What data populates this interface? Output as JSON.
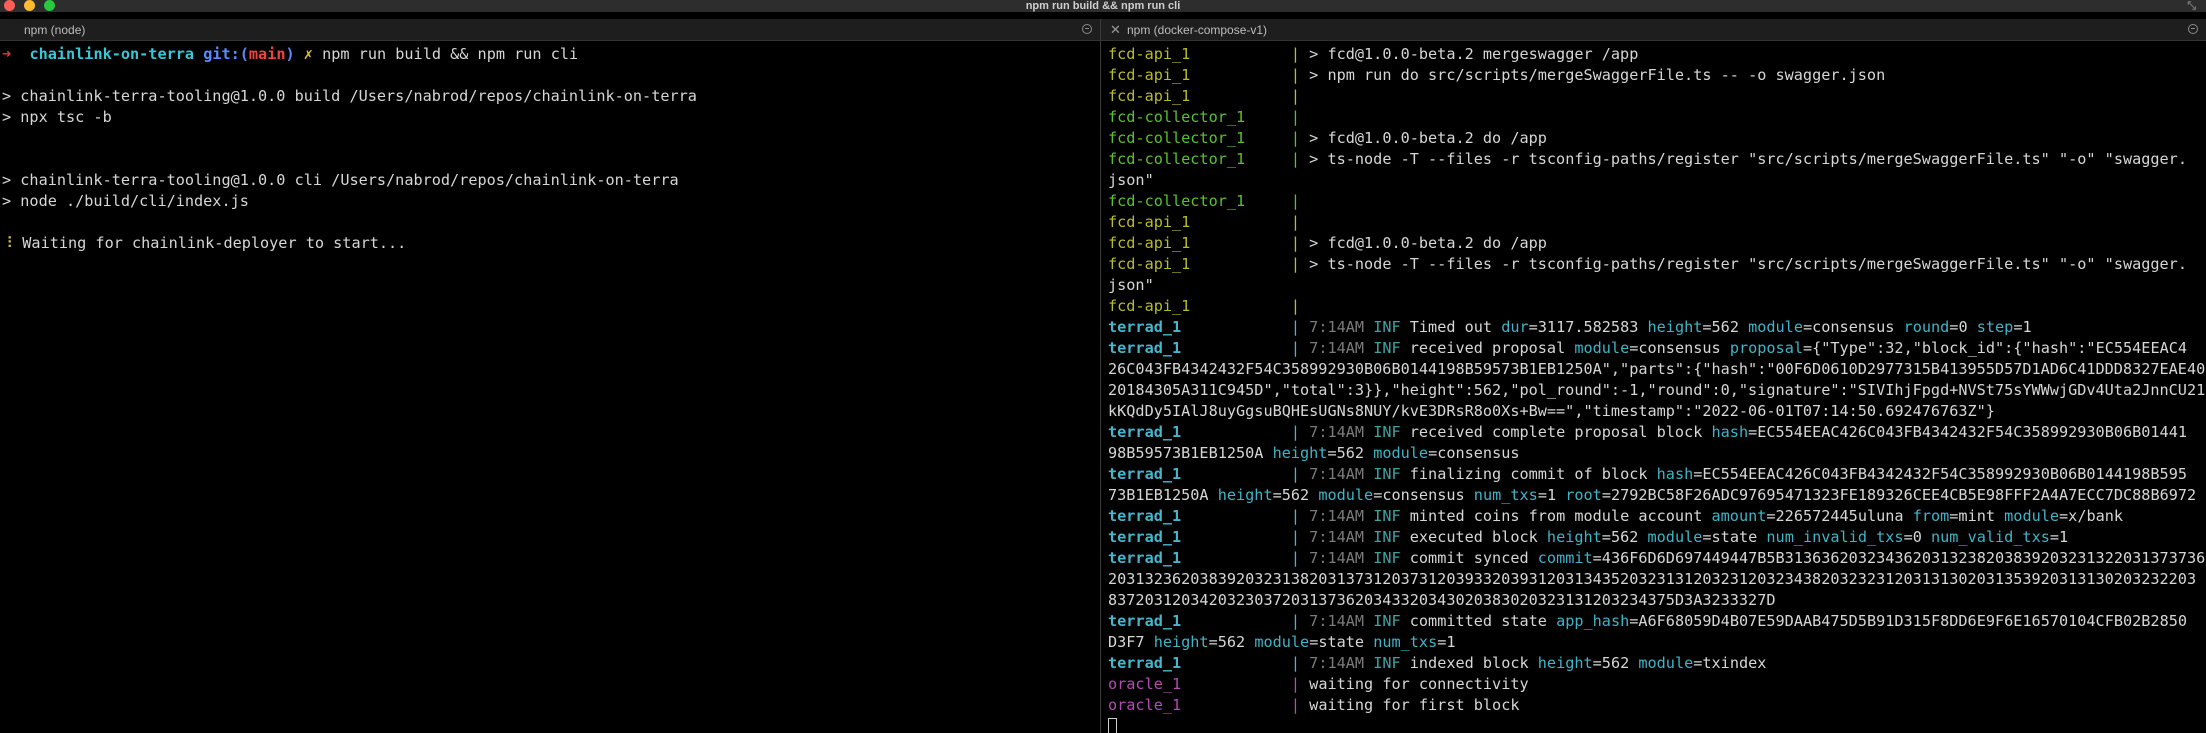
{
  "window": {
    "title": "npm run build && npm run cli",
    "traffic_colors": {
      "close": "#ff5f57",
      "minimize": "#febc2e",
      "maximize": "#28c840"
    }
  },
  "panes": {
    "left": {
      "tab": "npm (node)"
    },
    "right": {
      "tab": "npm (docker-compose-v1)"
    }
  },
  "left_terminal": {
    "prompt": {
      "arrow": "➜",
      "repo": "chainlink-on-terra",
      "git_label": "git:(",
      "branch": "main",
      "git_close": ")",
      "dirty": "✗",
      "command": "npm run build && npm run cli"
    },
    "lines": [
      "",
      "> chainlink-terra-tooling@1.0.0 build /Users/nabrod/repos/chainlink-on-terra",
      "> npx tsc -b",
      "",
      "",
      "> chainlink-terra-tooling@1.0.0 cli /Users/nabrod/repos/chainlink-on-terra",
      "> node ./build/cli/index.js",
      ""
    ],
    "status": {
      "spinner": "⠸",
      "text": "Waiting for chainlink-deployer to start..."
    }
  },
  "right_terminal": {
    "colors": {
      "fcd-api": "#b9bc2b",
      "fcd-collector": "#57c22e",
      "terrad": "#47b5cc",
      "oracle": "#b54bb5"
    },
    "lines": [
      {
        "src": "fcd-api_1",
        "kind": "api",
        "text": "> fcd@1.0.0-beta.2 mergeswagger /app"
      },
      {
        "src": "fcd-api_1",
        "kind": "api",
        "text": "> npm run do src/scripts/mergeSwaggerFile.ts -- -o swagger.json"
      },
      {
        "src": "fcd-api_1",
        "kind": "api",
        "text": ""
      },
      {
        "src": "fcd-collector_1",
        "kind": "coll",
        "text": ""
      },
      {
        "src": "fcd-collector_1",
        "kind": "coll",
        "text": "> fcd@1.0.0-beta.2 do /app"
      },
      {
        "src": "fcd-collector_1",
        "kind": "coll",
        "text": "> ts-node -T --files -r tsconfig-paths/register \"src/scripts/mergeSwaggerFile.ts\" \"-o\" \"swagger."
      },
      {
        "src": "",
        "kind": "cont",
        "text": "json\""
      },
      {
        "src": "fcd-collector_1",
        "kind": "coll",
        "text": ""
      },
      {
        "src": "fcd-api_1",
        "kind": "api",
        "text": ""
      },
      {
        "src": "fcd-api_1",
        "kind": "api",
        "text": "> fcd@1.0.0-beta.2 do /app"
      },
      {
        "src": "fcd-api_1",
        "kind": "api",
        "text": "> ts-node -T --files -r tsconfig-paths/register \"src/scripts/mergeSwaggerFile.ts\" \"-o\" \"swagger."
      },
      {
        "src": "",
        "kind": "cont",
        "text": "json\""
      },
      {
        "src": "fcd-api_1",
        "kind": "api",
        "text": ""
      },
      {
        "src": "terrad_1",
        "kind": "terrad",
        "segs": [
          [
            "ts",
            "7:14AM "
          ],
          [
            "inf",
            "INF "
          ],
          [
            "t",
            "Timed out "
          ],
          [
            "k",
            "dur"
          ],
          [
            "t",
            "=3117.582583 "
          ],
          [
            "k",
            "height"
          ],
          [
            "t",
            "=562 "
          ],
          [
            "k",
            "module"
          ],
          [
            "t",
            "=consensus "
          ],
          [
            "k",
            "round"
          ],
          [
            "t",
            "=0 "
          ],
          [
            "k",
            "step"
          ],
          [
            "t",
            "=1"
          ]
        ]
      },
      {
        "src": "terrad_1",
        "kind": "terrad",
        "segs": [
          [
            "ts",
            "7:14AM "
          ],
          [
            "inf",
            "INF "
          ],
          [
            "t",
            "received proposal "
          ],
          [
            "k",
            "module"
          ],
          [
            "t",
            "=consensus "
          ],
          [
            "k",
            "proposal"
          ],
          [
            "t",
            "={\"Type\":32,\"block_id\":{\"hash\":\"EC554EEAC4"
          ]
        ]
      },
      {
        "src": "",
        "kind": "cont",
        "text": "26C043FB4342432F54C358992930B06B0144198B59573B1EB1250A\",\"parts\":{\"hash\":\"00F6D0610D2977315B413955D57D1AD6C41DDD8327EAE40"
      },
      {
        "src": "",
        "kind": "cont",
        "text": "20184305A311C945D\",\"total\":3}},\"height\":562,\"pol_round\":-1,\"round\":0,\"signature\":\"SIVIhjFpgd+NVSt75sYWWwjGDv4Uta2JnnCU21"
      },
      {
        "src": "",
        "kind": "cont",
        "text": "kKQdDy5IAlJ8uyGgsuBQHEsUGNs8NUY/kvE3DRsR8o0Xs+Bw==\",\"timestamp\":\"2022-06-01T07:14:50.692476763Z\"}"
      },
      {
        "src": "terrad_1",
        "kind": "terrad",
        "segs": [
          [
            "ts",
            "7:14AM "
          ],
          [
            "inf",
            "INF "
          ],
          [
            "t",
            "received complete proposal block "
          ],
          [
            "k",
            "hash"
          ],
          [
            "t",
            "=EC554EEAC426C043FB4342432F54C358992930B06B01441"
          ]
        ]
      },
      {
        "src": "",
        "kind": "cont",
        "segs": [
          [
            "t",
            "98B59573B1EB1250A "
          ],
          [
            "k",
            "height"
          ],
          [
            "t",
            "=562 "
          ],
          [
            "k",
            "module"
          ],
          [
            "t",
            "=consensus"
          ]
        ]
      },
      {
        "src": "terrad_1",
        "kind": "terrad",
        "segs": [
          [
            "ts",
            "7:14AM "
          ],
          [
            "inf",
            "INF "
          ],
          [
            "t",
            "finalizing commit of block "
          ],
          [
            "k",
            "hash"
          ],
          [
            "t",
            "=EC554EEAC426C043FB4342432F54C358992930B06B0144198B595"
          ]
        ]
      },
      {
        "src": "",
        "kind": "cont",
        "segs": [
          [
            "t",
            "73B1EB1250A "
          ],
          [
            "k",
            "height"
          ],
          [
            "t",
            "=562 "
          ],
          [
            "k",
            "module"
          ],
          [
            "t",
            "=consensus "
          ],
          [
            "k",
            "num_txs"
          ],
          [
            "t",
            "=1 "
          ],
          [
            "k",
            "root"
          ],
          [
            "t",
            "=2792BC58F26ADC97695471323FE189326CEE4CB5E98FFF2A4A7ECC7DC88B6972"
          ]
        ]
      },
      {
        "src": "terrad_1",
        "kind": "terrad",
        "segs": [
          [
            "ts",
            "7:14AM "
          ],
          [
            "inf",
            "INF "
          ],
          [
            "t",
            "minted coins from module account "
          ],
          [
            "k",
            "amount"
          ],
          [
            "t",
            "=226572445uluna "
          ],
          [
            "k",
            "from"
          ],
          [
            "t",
            "=mint "
          ],
          [
            "k",
            "module"
          ],
          [
            "t",
            "=x/bank"
          ]
        ]
      },
      {
        "src": "terrad_1",
        "kind": "terrad",
        "segs": [
          [
            "ts",
            "7:14AM "
          ],
          [
            "inf",
            "INF "
          ],
          [
            "t",
            "executed block "
          ],
          [
            "k",
            "height"
          ],
          [
            "t",
            "=562 "
          ],
          [
            "k",
            "module"
          ],
          [
            "t",
            "=state "
          ],
          [
            "k",
            "num_invalid_txs"
          ],
          [
            "t",
            "=0 "
          ],
          [
            "k",
            "num_valid_txs"
          ],
          [
            "t",
            "=1"
          ]
        ]
      },
      {
        "src": "terrad_1",
        "kind": "terrad",
        "segs": [
          [
            "ts",
            "7:14AM "
          ],
          [
            "inf",
            "INF "
          ],
          [
            "t",
            "commit synced "
          ],
          [
            "k",
            "commit"
          ],
          [
            "t",
            "=436F6D6D697449447B5B3136362032343620313238203839203231322031373736"
          ]
        ]
      },
      {
        "src": "",
        "kind": "cont",
        "text": "20313236203839203231382031373120373120393320393120313435203231312032312032343820323231203131302031353920313130203232203"
      },
      {
        "src": "",
        "kind": "cont",
        "text": "8372031203420323037203137362034332034302038302032313120323437​5D3A3233327D"
      },
      {
        "src": "terrad_1",
        "kind": "terrad",
        "segs": [
          [
            "ts",
            "7:14AM "
          ],
          [
            "inf",
            "INF "
          ],
          [
            "t",
            "committed state "
          ],
          [
            "k",
            "app_hash"
          ],
          [
            "t",
            "=A6F68059D4B07E59DAAB475D5B91D315F8DD6E9F6E16570104CFB02B2850"
          ]
        ]
      },
      {
        "src": "",
        "kind": "cont",
        "segs": [
          [
            "t",
            "D3F7 "
          ],
          [
            "k",
            "height"
          ],
          [
            "t",
            "=562 "
          ],
          [
            "k",
            "module"
          ],
          [
            "t",
            "=state "
          ],
          [
            "k",
            "num_txs"
          ],
          [
            "t",
            "=1"
          ]
        ]
      },
      {
        "src": "terrad_1",
        "kind": "terrad",
        "segs": [
          [
            "ts",
            "7:14AM "
          ],
          [
            "inf",
            "INF "
          ],
          [
            "t",
            "indexed block "
          ],
          [
            "k",
            "height"
          ],
          [
            "t",
            "=562 "
          ],
          [
            "k",
            "module"
          ],
          [
            "t",
            "=txindex"
          ]
        ]
      },
      {
        "src": "oracle_1",
        "kind": "oracle",
        "text": "waiting for connectivity"
      },
      {
        "src": "oracle_1",
        "kind": "oracle",
        "text": "waiting for first block"
      }
    ]
  }
}
